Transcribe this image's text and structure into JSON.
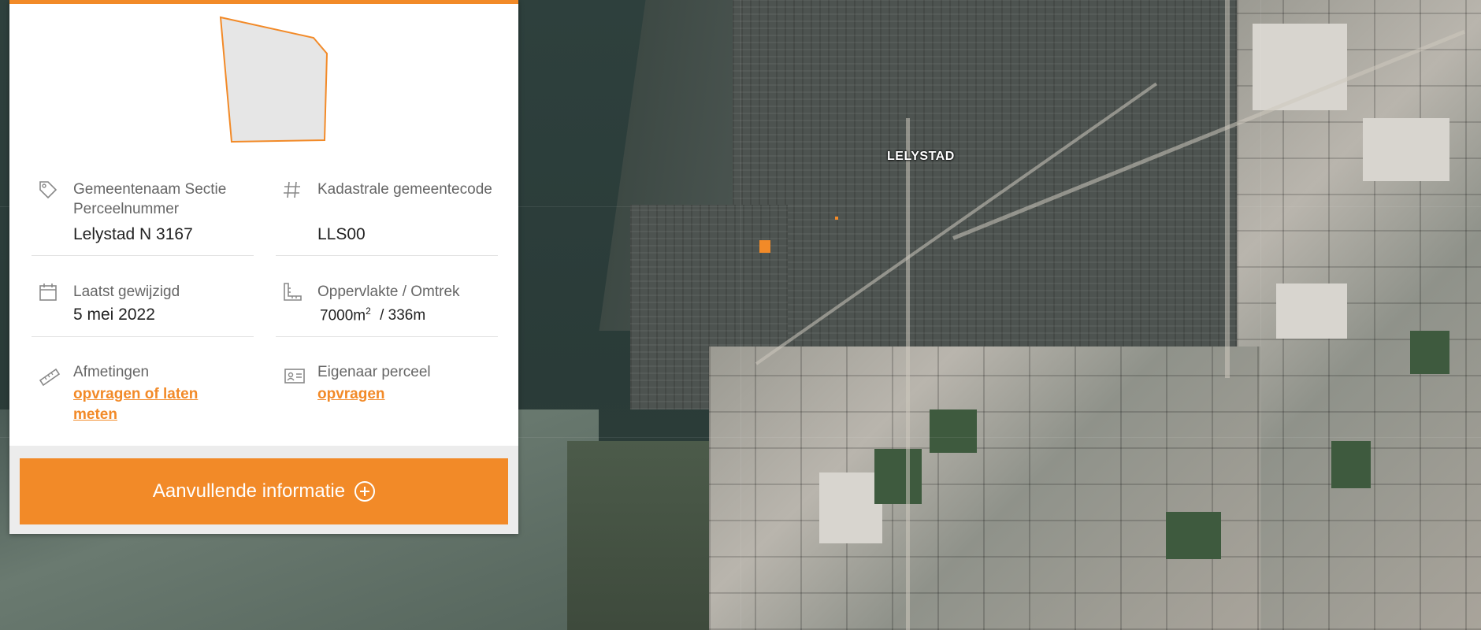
{
  "map": {
    "city_label": "LELYSTAD"
  },
  "panel": {
    "accent_color": "#f28a28",
    "parcel_id": {
      "icon": "tag-icon",
      "label": "Gemeentenaam Sectie Perceelnummer",
      "value": "Lelystad N 3167"
    },
    "cadastral_code": {
      "icon": "hash-icon",
      "label": "Kadastrale gemeentecode",
      "value": "LLS00"
    },
    "last_modified": {
      "icon": "calendar-icon",
      "label": "Laatst gewijzigd",
      "value": "5 mei 2022"
    },
    "area": {
      "icon": "ruler-square-icon",
      "label": "Oppervlakte / Omtrek",
      "area_value": "7000m",
      "area_sup": "2",
      "perimeter_value": "/ 336m"
    },
    "dimensions": {
      "icon": "ruler-icon",
      "label": "Afmetingen",
      "link": "opvragen of laten meten"
    },
    "owner": {
      "icon": "id-card-icon",
      "label": "Eigenaar perceel",
      "link": "opvragen"
    },
    "cta_label": "Aanvullende informatie",
    "cta_icon": "plus-circle-icon"
  }
}
